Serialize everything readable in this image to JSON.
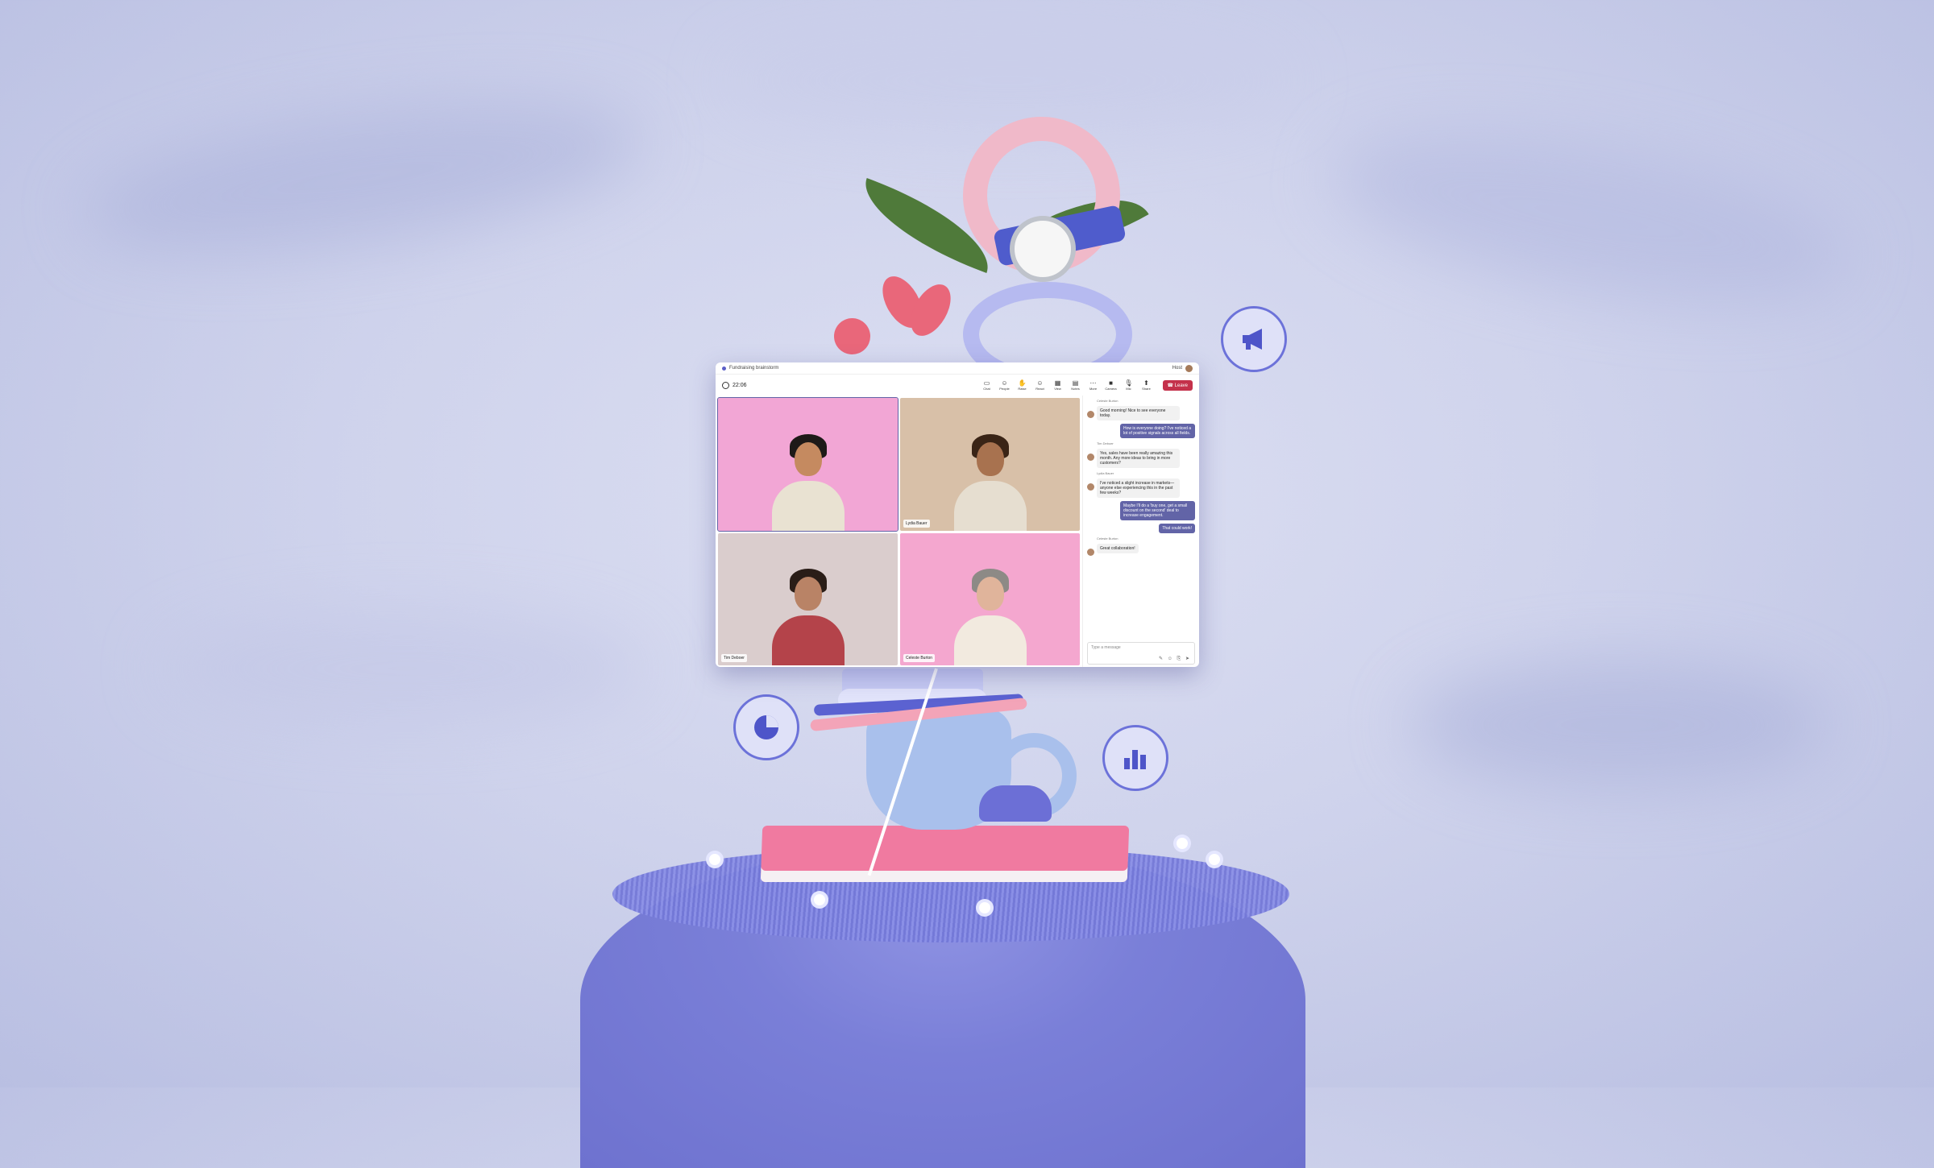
{
  "window": {
    "title": "Fundraising brainstorm",
    "organizer_label": "Host",
    "timer": "22:06"
  },
  "toolbar": {
    "items": [
      {
        "label": "Chat",
        "icon": "chat-icon"
      },
      {
        "label": "People",
        "icon": "people-icon"
      },
      {
        "label": "Raise",
        "icon": "hand-icon"
      },
      {
        "label": "React",
        "icon": "emoji-icon"
      },
      {
        "label": "View",
        "icon": "grid-icon"
      },
      {
        "label": "Notes",
        "icon": "notes-icon"
      },
      {
        "label": "More",
        "icon": "more-icon"
      }
    ],
    "camera_label": "Camera",
    "mic_label": "Mic",
    "share_label": "Share",
    "leave_label": "Leave"
  },
  "participants": [
    {
      "name": "",
      "bg": "#f2a6d5",
      "skin": "#c58a60",
      "hair": "#1e1a18",
      "shirt": "#e9e2d2"
    },
    {
      "name": "Lydia Bauer",
      "bg": "#d8c0a8",
      "skin": "#a8724f",
      "hair": "#3a2416",
      "shirt": "#e6ded0"
    },
    {
      "name": "Tim Deboer",
      "bg": "#dacdcd",
      "skin": "#b98366",
      "hair": "#2a1d17",
      "shirt": "#b4434a"
    },
    {
      "name": "Celeste Burton",
      "bg": "#f4a7cf",
      "skin": "#e0b49b",
      "hair": "#8d8a86",
      "shirt": "#f2eadf"
    }
  ],
  "chat": {
    "messages": [
      {
        "dir": "in",
        "sender": "Celeste Burton",
        "text": "Good morning! Nice to see everyone today."
      },
      {
        "dir": "out",
        "text": "How is everyone doing? I've noticed a lot of positive signals across all fields."
      },
      {
        "dir": "in",
        "sender": "Tim Deboer",
        "text": "Yes, sales have been really amazing this month. Any more ideas to bring in more customers?"
      },
      {
        "dir": "in",
        "sender": "Lydia Bauer",
        "text": "I've noticed a slight increase in markets—anyone else experiencing this in the past few weeks?"
      },
      {
        "dir": "out",
        "text": "Maybe I'll do a 'buy one, get a small discount on the second' deal to increase engagement."
      },
      {
        "dir": "out",
        "text": "That could work!"
      },
      {
        "dir": "in",
        "sender": "Celeste Burton",
        "text": "Great collaboration!"
      }
    ],
    "compose_placeholder": "Type a message"
  },
  "decor_icons": [
    {
      "name": "megaphone-icon"
    },
    {
      "name": "pie-chart-icon"
    },
    {
      "name": "bar-chart-icon"
    }
  ],
  "colors": {
    "accent": "#6264a7",
    "leave": "#c4314b",
    "background": "#cfd3ec"
  }
}
